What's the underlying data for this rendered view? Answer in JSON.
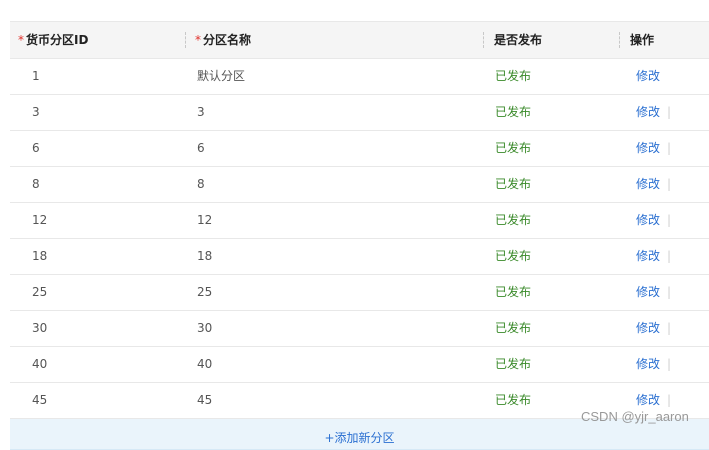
{
  "columns": {
    "id": {
      "required": "*",
      "label": "货币分区ID"
    },
    "name": {
      "required": "*",
      "label": "分区名称"
    },
    "published": {
      "label": "是否发布"
    },
    "action": {
      "label": "操作"
    }
  },
  "rows": [
    {
      "id": "1",
      "name": "默认分区",
      "published": "已发布",
      "action": "修改",
      "sep": ""
    },
    {
      "id": "3",
      "name": "3",
      "published": "已发布",
      "action": "修改",
      "sep": "|"
    },
    {
      "id": "6",
      "name": "6",
      "published": "已发布",
      "action": "修改",
      "sep": "|"
    },
    {
      "id": "8",
      "name": "8",
      "published": "已发布",
      "action": "修改",
      "sep": "|"
    },
    {
      "id": "12",
      "name": "12",
      "published": "已发布",
      "action": "修改",
      "sep": "|"
    },
    {
      "id": "18",
      "name": "18",
      "published": "已发布",
      "action": "修改",
      "sep": "|"
    },
    {
      "id": "25",
      "name": "25",
      "published": "已发布",
      "action": "修改",
      "sep": "|"
    },
    {
      "id": "30",
      "name": "30",
      "published": "已发布",
      "action": "修改",
      "sep": "|"
    },
    {
      "id": "40",
      "name": "40",
      "published": "已发布",
      "action": "修改",
      "sep": "|"
    },
    {
      "id": "45",
      "name": "45",
      "published": "已发布",
      "action": "修改",
      "sep": "|"
    }
  ],
  "add_row": {
    "label": "+添加新分区"
  },
  "watermark": "CSDN @yjr_aaron"
}
